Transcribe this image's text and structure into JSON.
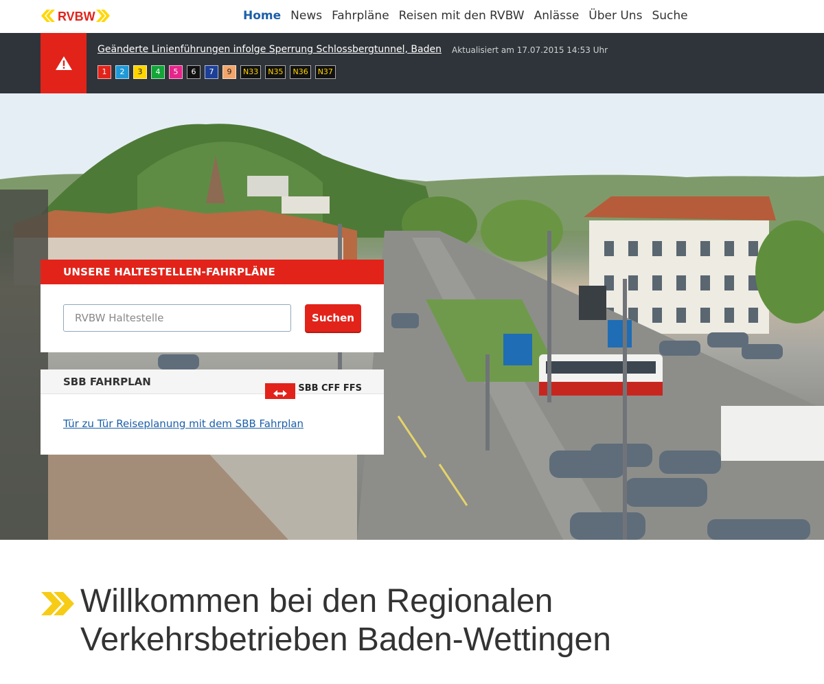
{
  "brand": {
    "name": "RVBW",
    "accent": "#e2231a",
    "yellow": "#ffd700",
    "link_color": "#1c5fa8"
  },
  "nav": {
    "items": [
      {
        "label": "Home",
        "active": true
      },
      {
        "label": "News"
      },
      {
        "label": "Fahrpläne"
      },
      {
        "label": "Reisen mit den RVBW"
      },
      {
        "label": "Anlässe"
      },
      {
        "label": "Über Uns"
      },
      {
        "label": "Suche"
      }
    ]
  },
  "alert": {
    "icon": "warning-icon",
    "title": "Geänderte Linienführungen infolge Sperrung Schlossbergtunnel, Baden",
    "updated": "Aktualisiert am 17.07.2015 14:53 Uhr",
    "lines": [
      {
        "label": "1",
        "bg": "#e2231a",
        "fg": "#ffffff"
      },
      {
        "label": "2",
        "bg": "#1f9ad6",
        "fg": "#ffffff"
      },
      {
        "label": "3",
        "bg": "#ffd500",
        "fg": "#222222"
      },
      {
        "label": "4",
        "bg": "#13a538",
        "fg": "#ffffff"
      },
      {
        "label": "5",
        "bg": "#e5258a",
        "fg": "#ffffff"
      },
      {
        "label": "6",
        "bg": "#111111",
        "fg": "#ffffff"
      },
      {
        "label": "7",
        "bg": "#1d3f97",
        "fg": "#ffffff"
      },
      {
        "label": "9",
        "bg": "#f3a56b",
        "fg": "#222222"
      },
      {
        "label": "N33",
        "bg": "#111111",
        "fg": "#ffd500"
      },
      {
        "label": "N35",
        "bg": "#111111",
        "fg": "#ffd500"
      },
      {
        "label": "N36",
        "bg": "#111111",
        "fg": "#ffd500"
      },
      {
        "label": "N37",
        "bg": "#111111",
        "fg": "#ffd500"
      }
    ]
  },
  "stops_panel": {
    "heading": "UNSERE HALTESTELLEN-FAHRPLÄNE",
    "input_placeholder": "RVBW Haltestelle",
    "button_label": "Suchen"
  },
  "sbb_panel": {
    "heading": "SBB FAHRPLAN",
    "logo_text": "SBB CFF FFS",
    "link_text": "Tür zu Tür Reiseplanung mit dem SBB Fahrplan"
  },
  "welcome": {
    "line1": "Willkommen bei den Regionalen",
    "line2": "Verkehrsbetrieben Baden-Wettingen"
  }
}
